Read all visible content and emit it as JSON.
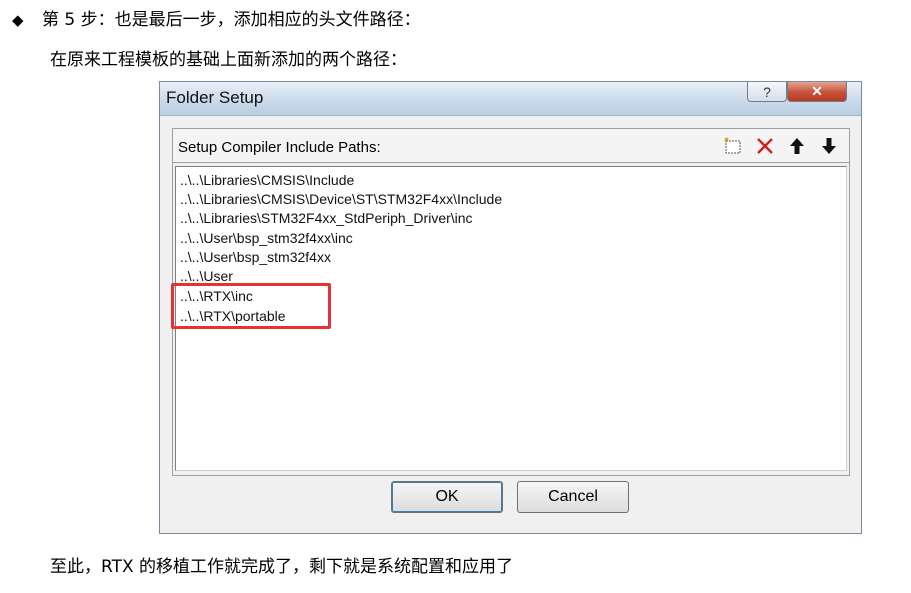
{
  "doc": {
    "bullet": "◆",
    "step_heading": "第 5 步：也是最后一步，添加相应的头文件路径：",
    "intro": "在原来工程模板的基础上面新添加的两个路径：",
    "conclusion": "至此，RTX 的移植工作就完成了，剩下就是系统配置和应用了"
  },
  "dialog": {
    "title": "Folder Setup",
    "help_label": "?",
    "close_label": "✕",
    "header_label": "Setup Compiler Include Paths:",
    "toolbar_icons": [
      "new-folder-icon",
      "delete-icon",
      "move-up-icon",
      "move-down-icon"
    ],
    "paths": [
      "..\\..\\Libraries\\CMSIS\\Include",
      "..\\..\\Libraries\\CMSIS\\Device\\ST\\STM32F4xx\\Include",
      "..\\..\\Libraries\\STM32F4xx_StdPeriph_Driver\\inc",
      "..\\..\\User\\bsp_stm32f4xx\\inc",
      "..\\..\\User\\bsp_stm32f4xx",
      "..\\..\\User",
      "..\\..\\RTX\\inc",
      "..\\..\\RTX\\portable"
    ],
    "highlighted_paths": [
      "..\\..\\RTX\\inc",
      "..\\..\\RTX\\portable"
    ],
    "highlight_color": "#e53333",
    "ok_label": "OK",
    "cancel_label": "Cancel"
  }
}
